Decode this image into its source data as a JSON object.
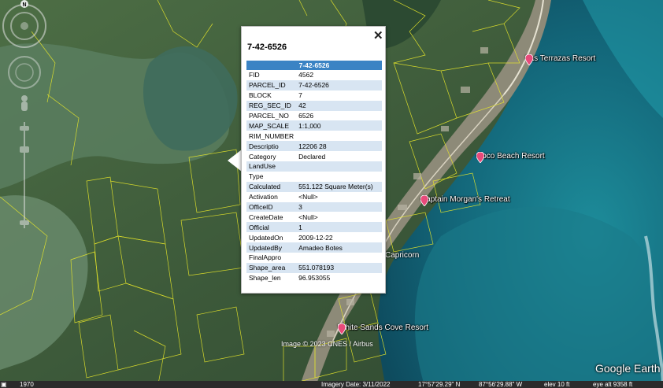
{
  "popup": {
    "title": "7-42-6526",
    "header": "7-42-6526",
    "close_icon": "close-icon",
    "rows": [
      {
        "key": "FID",
        "value": "4562"
      },
      {
        "key": "PARCEL_ID",
        "value": "7-42-6526"
      },
      {
        "key": "BLOCK",
        "value": "7"
      },
      {
        "key": "REG_SEC_ID",
        "value": "42"
      },
      {
        "key": "PARCEL_NO",
        "value": "6526"
      },
      {
        "key": "MAP_SCALE",
        "value": "1:1,000"
      },
      {
        "key": "RIM_NUMBER",
        "value": ""
      },
      {
        "key": "Descriptio",
        "value": "12206 28"
      },
      {
        "key": "Category",
        "value": "Declared"
      },
      {
        "key": "LandUse",
        "value": ""
      },
      {
        "key": "Type",
        "value": ""
      },
      {
        "key": "Calculated",
        "value": "551.122 Square Meter(s)"
      },
      {
        "key": "Activation",
        "value": "<Null>"
      },
      {
        "key": "OfficeID",
        "value": "3"
      },
      {
        "key": "CreateDate",
        "value": "<Null>"
      },
      {
        "key": "Official",
        "value": "1"
      },
      {
        "key": "UpdatedOn",
        "value": "2009-12-22"
      },
      {
        "key": "UpdatedBy",
        "value": "Amadeo Botes"
      },
      {
        "key": "FinalAppro",
        "value": ""
      },
      {
        "key": "Shape_area",
        "value": "551.078193"
      },
      {
        "key": "Shape_len",
        "value": "96.953055"
      }
    ]
  },
  "map": {
    "places": {
      "las_terrazas": "Las Terrazas Resort",
      "coco_beach": "Coco Beach Resort",
      "captain_morgan": "Captain Morgan's Retreat",
      "capricorn": "Capricorn",
      "white_sands": "White Sands Cove Resort"
    },
    "credit": "Image © 2023 CNES / Airbus",
    "logo": "Google Earth",
    "pin_color": "#e84a7a",
    "parcel_color": "#e8e82a"
  },
  "navigation": {
    "north_label": "N"
  },
  "statusbar": {
    "historical_year": "1970",
    "imagery_date": "Imagery Date: 3/11/2022",
    "latitude": "17°57'29.29\" N",
    "longitude": "87°56'29.88\" W",
    "elevation": "elev   10 ft",
    "eye_alt": "eye alt  9358 ft"
  }
}
